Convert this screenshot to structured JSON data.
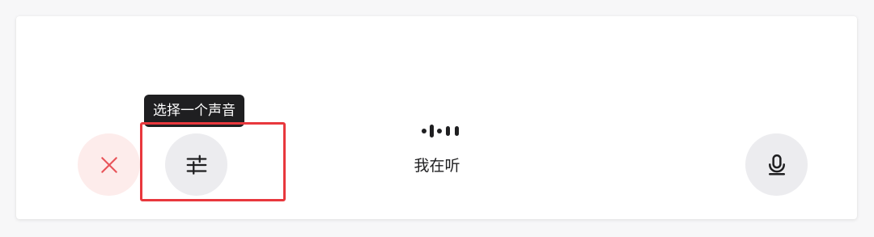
{
  "tooltip": {
    "text": "选择一个声音"
  },
  "status": {
    "text": "我在听"
  },
  "icons": {
    "close": "close-icon",
    "settings": "sliders-icon",
    "microphone": "microphone-icon",
    "listening": "audio-wave-icon"
  },
  "colors": {
    "close_accent": "#e8545a",
    "highlight": "#e8383d"
  }
}
